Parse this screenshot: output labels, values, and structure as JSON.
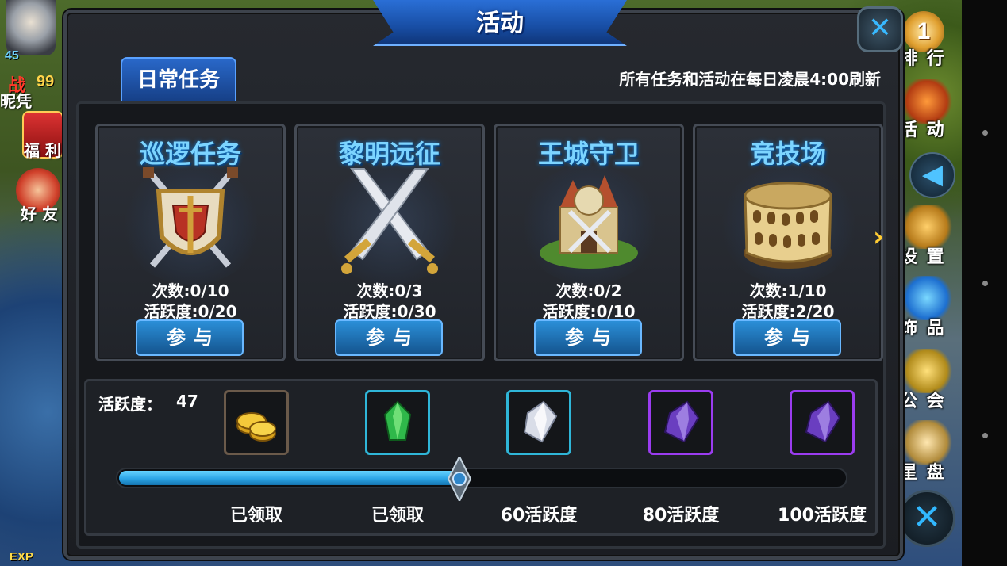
{
  "hud_left": {
    "level": "45",
    "power_icon": "战",
    "power_value": "99",
    "label_partial": "昵凭",
    "fuli_label": "福 利",
    "friend_label": "好 友",
    "exp_label": "EXP"
  },
  "hud_right": {
    "rank_number": "1",
    "rank_label": "排 行",
    "activity_label": "活 动",
    "settings_label": "设 置",
    "accessory_label": "饰 品",
    "guild_label": "公 会",
    "star_label": "星 盘"
  },
  "panel": {
    "title": "活动",
    "tab_daily": "日常任务",
    "refresh_note": "所有任务和活动在每日凌晨4:00刷新"
  },
  "cards": [
    {
      "title": "巡逻任务",
      "count": "次数:0/10",
      "activity": "活跃度:0/20",
      "button": "参与",
      "icon": "shield-swords-icon"
    },
    {
      "title": "黎明远征",
      "count": "次数:0/3",
      "activity": "活跃度:0/30",
      "button": "参与",
      "icon": "crossed-swords-icon"
    },
    {
      "title": "王城守卫",
      "count": "次数:0/2",
      "activity": "活跃度:0/10",
      "button": "参与",
      "icon": "castle-icon"
    },
    {
      "title": "竞技场",
      "count": "次数:1/10",
      "activity": "活跃度:2/20",
      "button": "参与",
      "icon": "colosseum-icon"
    }
  ],
  "rewards": {
    "activity_label": "活跃度：",
    "activity_value": "47",
    "progress": 0.47,
    "items": [
      {
        "caption": "已领取",
        "icon": "gold-coins-icon",
        "border_color": "#6b5a4a"
      },
      {
        "caption": "已领取",
        "icon": "green-crystal-icon",
        "border_color": "#2fb6d8"
      },
      {
        "caption": "60活跃度",
        "icon": "white-crystal-icon",
        "border_color": "#2fb6d8"
      },
      {
        "caption": "80活跃度",
        "icon": "purple-crystal-icon",
        "border_color": "#9b3cf0"
      },
      {
        "caption": "100活跃度",
        "icon": "purple-crystal-icon",
        "border_color": "#9b3cf0"
      }
    ]
  },
  "colors": {
    "accent_blue": "#2b8fd8",
    "title_cyan": "#7cd4ff",
    "progress_fill": "#2ca5e6"
  }
}
